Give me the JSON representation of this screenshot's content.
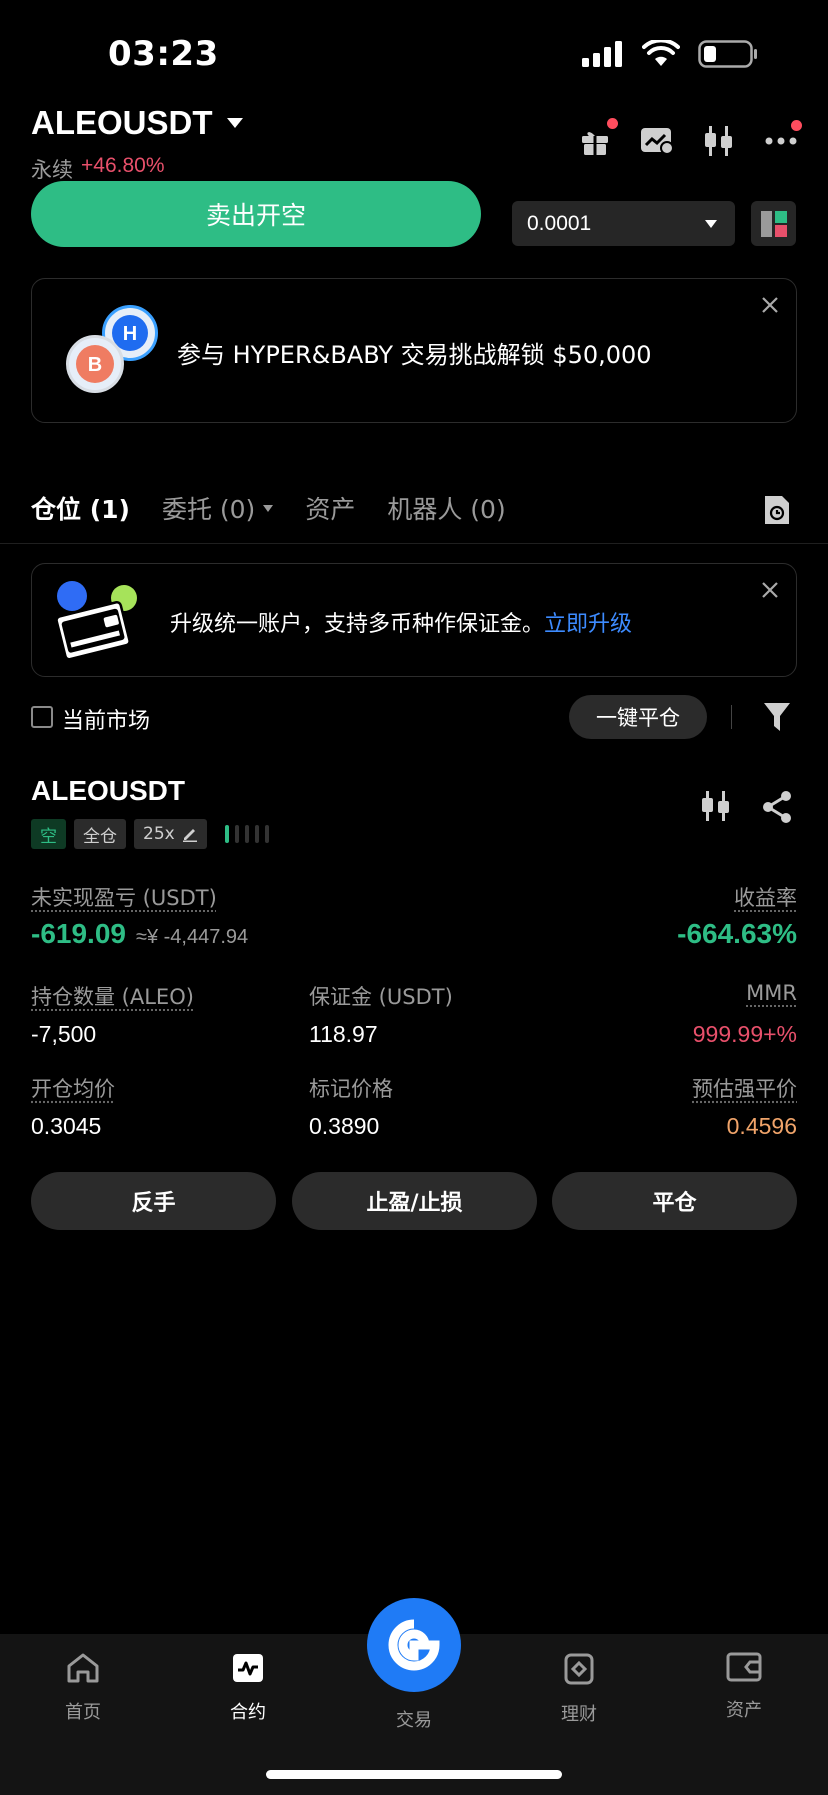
{
  "status_bar": {
    "time": "03:23"
  },
  "header": {
    "pair": "ALEOUSDT",
    "market_type": "永续",
    "change": "+46.80%"
  },
  "action_row": {
    "sell_label": "卖出开空",
    "qty_value": "0.0001"
  },
  "promo": {
    "text": "参与 HYPER&BABY 交易挑战解锁 $50,000",
    "coin_letters": [
      "H",
      "B"
    ]
  },
  "tabs": [
    {
      "label": "仓位 (1)"
    },
    {
      "label": "委托 (0)"
    },
    {
      "label": "资产"
    },
    {
      "label": "机器人 (0)"
    }
  ],
  "upgrade": {
    "text": "升级统一账户，支持多币种作保证金。",
    "link": "立即升级"
  },
  "filter": {
    "current_market": "当前市场",
    "close_all": "一键平仓"
  },
  "position": {
    "symbol": "ALEOUSDT",
    "side": "空",
    "margin_mode": "全仓",
    "leverage": "25x",
    "risk_level_bars_on": 1,
    "unrealized_pnl_label": "未实现盈亏 (USDT)",
    "unrealized_pnl": "-619.09",
    "unrealized_pnl_cny": "≈¥ -4,447.94",
    "roe_label": "收益率",
    "roe": "-664.63%",
    "size_label": "持仓数量 (ALEO)",
    "size": "-7,500",
    "margin_label": "保证金 (USDT)",
    "margin": "118.97",
    "mmr_label": "MMR",
    "mmr": "999.99+%",
    "entry_label": "开仓均价",
    "entry": "0.3045",
    "mark_label": "标记价格",
    "mark": "0.3890",
    "liq_label": "预估强平价",
    "liq": "0.4596",
    "buttons": {
      "reverse": "反手",
      "tp_sl": "止盈/止损",
      "close": "平仓"
    }
  },
  "bottom_nav": [
    {
      "label": "首页",
      "icon": "home-icon"
    },
    {
      "label": "合约",
      "icon": "futures-icon"
    },
    {
      "label": "交易",
      "icon": "trade-icon"
    },
    {
      "label": "理财",
      "icon": "earn-icon"
    },
    {
      "label": "资产",
      "icon": "wallet-icon"
    }
  ],
  "colors": {
    "green": "#2ebd85",
    "red": "#e8506b",
    "blue": "#1f7bf6",
    "orange": "#f0a46a"
  }
}
